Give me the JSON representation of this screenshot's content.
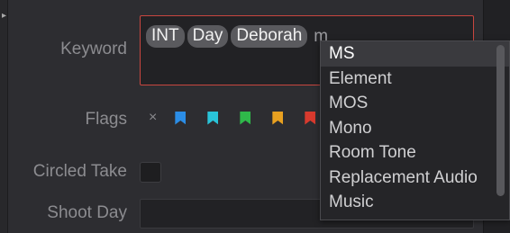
{
  "labels": {
    "keyword": "Keyword",
    "flags": "Flags",
    "circled_take": "Circled Take",
    "shoot_day": "Shoot Day"
  },
  "keyword": {
    "tags": [
      "INT",
      "Day",
      "Deborah"
    ],
    "typed_text": "m",
    "focus_border_color": "#c8463f"
  },
  "flags": {
    "clear_symbol": "×",
    "colors": [
      "#2b8de6",
      "#29c3d8",
      "#2fb84a",
      "#e8a020",
      "#d83a2e"
    ]
  },
  "circled_take": {
    "checked": false
  },
  "shoot_day": {
    "value": ""
  },
  "dropdown": {
    "selected_index": 0,
    "items": [
      "MS",
      "Element",
      "MOS",
      "Mono",
      "Room Tone",
      "Replacement Audio",
      "Music"
    ]
  }
}
